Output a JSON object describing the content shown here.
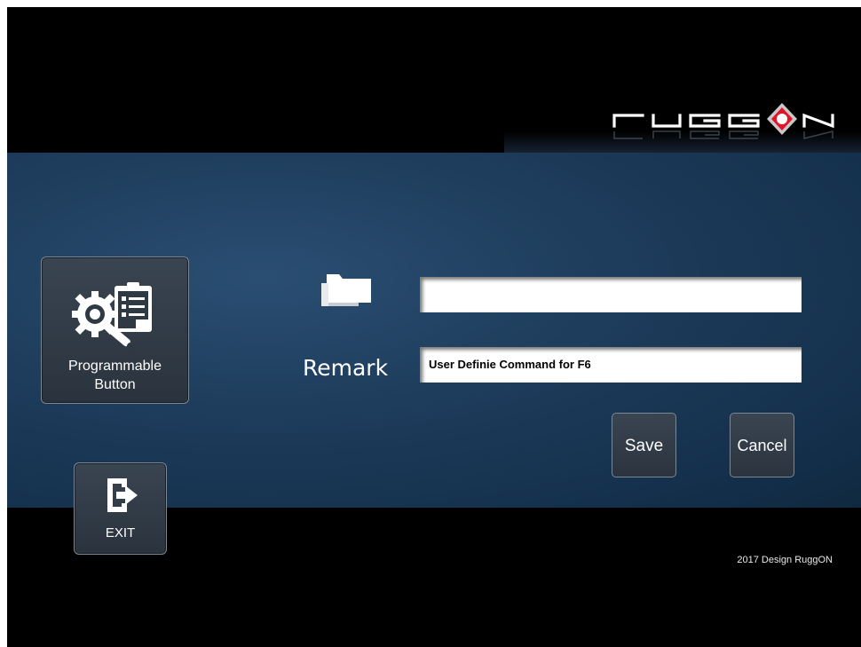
{
  "header": {
    "logo_text": "RUGGON",
    "brand_accent": "#e0142a"
  },
  "sidebar": {
    "programmable_button": {
      "label_line1": "Programmable",
      "label_line2": "Button",
      "icon": "gear-checklist-icon"
    },
    "exit_button": {
      "label": "EXIT",
      "icon": "exit-icon"
    }
  },
  "form": {
    "folder_icon": "folder-icon",
    "path_value": "",
    "remark_label": "Remark",
    "remark_value": "User Definie Command for F6"
  },
  "actions": {
    "save_label": "Save",
    "cancel_label": "Cancel"
  },
  "footer": {
    "copyright": "2017 Design RuggON"
  },
  "colors": {
    "background": "#000000",
    "band": "#1d3b5a",
    "tile": "#333c47",
    "tile_border": "#7b8794"
  }
}
